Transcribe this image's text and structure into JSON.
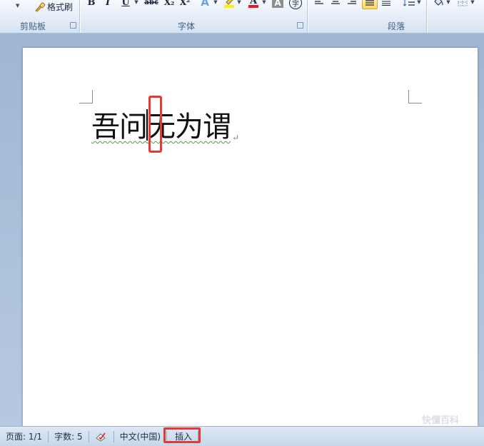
{
  "ribbon": {
    "clipboard": {
      "format_painter_label": "格式刷",
      "group_label": "剪贴板"
    },
    "font": {
      "group_label": "字体",
      "bold": "B",
      "italic": "I",
      "underline": "U",
      "strikethrough": "abc",
      "subscript": "X₂",
      "superscript": "X²",
      "text_effect": "A",
      "char_shading": "A",
      "enclose": "字"
    },
    "paragraph": {
      "group_label": "段落"
    }
  },
  "document": {
    "text_before_caret": "吾问",
    "text_after_caret": "无为谓",
    "paragraph_mark": "↵"
  },
  "statusbar": {
    "page": "页面: 1/1",
    "word_count": "字数: 5",
    "language": "中文(中国)",
    "insert_mode": "插入"
  },
  "watermark": "快懂百科",
  "colors": {
    "highlight": "#e53935",
    "font_color": "#e81c1c",
    "highlighter": "#ffef00"
  }
}
